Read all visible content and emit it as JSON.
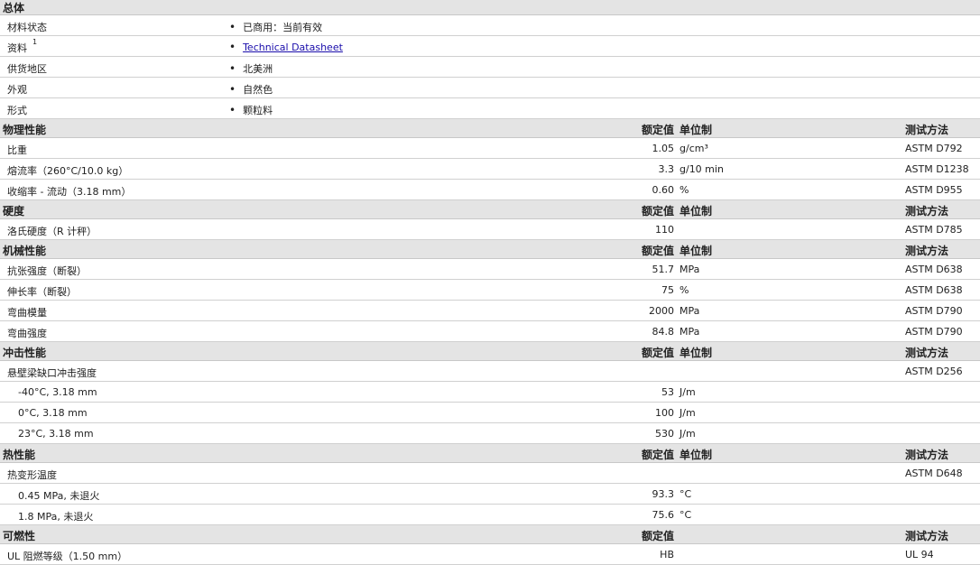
{
  "general": {
    "title": "总体",
    "rows": [
      {
        "label": "材料状态",
        "value": "已商用：当前有效"
      },
      {
        "label": "资料",
        "sup": "1",
        "value": "Technical Datasheet",
        "link": true
      },
      {
        "label": "供货地区",
        "value": "北美洲"
      },
      {
        "label": "外观",
        "value": "自然色"
      },
      {
        "label": "形式",
        "value": "颗粒料"
      }
    ]
  },
  "headers": {
    "value": "额定值",
    "unit": "单位制",
    "test": "测试方法"
  },
  "sections": [
    {
      "title": "物理性能",
      "unitHdr": true,
      "rows": [
        {
          "label": "比重",
          "value": "1.05",
          "unit": "g/cm³",
          "test": "ASTM D792"
        },
        {
          "label": "熔流率（260°C/10.0 kg）",
          "value": "3.3",
          "unit": "g/10 min",
          "test": "ASTM D1238"
        },
        {
          "label": "收缩率 - 流动（3.18 mm）",
          "value": "0.60",
          "unit": "%",
          "test": "ASTM D955"
        }
      ]
    },
    {
      "title": "硬度",
      "unitHdr": true,
      "rows": [
        {
          "label": "洛氏硬度（R 计秤）",
          "value": "110",
          "test": "ASTM D785"
        }
      ]
    },
    {
      "title": "机械性能",
      "unitHdr": true,
      "rows": [
        {
          "label": "抗张强度（断裂）",
          "value": "51.7",
          "unit": "MPa",
          "test": "ASTM D638"
        },
        {
          "label": "伸长率（断裂）",
          "value": "75",
          "unit": "%",
          "test": "ASTM D638"
        },
        {
          "label": "弯曲模量",
          "value": "2000",
          "unit": "MPa",
          "test": "ASTM D790"
        },
        {
          "label": "弯曲强度",
          "value": "84.8",
          "unit": "MPa",
          "test": "ASTM D790"
        }
      ]
    },
    {
      "title": "冲击性能",
      "unitHdr": true,
      "rows": [
        {
          "label": "悬壁梁缺口冲击强度",
          "test": "ASTM D256"
        },
        {
          "label": "-40°C, 3.18 mm",
          "sub": true,
          "value": "53",
          "unit": "J/m"
        },
        {
          "label": "0°C, 3.18 mm",
          "sub": true,
          "value": "100",
          "unit": "J/m"
        },
        {
          "label": "23°C, 3.18 mm",
          "sub": true,
          "value": "530",
          "unit": "J/m"
        }
      ]
    },
    {
      "title": "热性能",
      "unitHdr": true,
      "rows": [
        {
          "label": "热变形温度",
          "test": "ASTM D648"
        },
        {
          "label": "0.45 MPa, 未退火",
          "sub": true,
          "value": "93.3",
          "unit": "°C"
        },
        {
          "label": "1.8 MPa, 未退火",
          "sub": true,
          "value": "75.6",
          "unit": "°C"
        }
      ]
    },
    {
      "title": "可燃性",
      "unitHdr": false,
      "rows": [
        {
          "label": "UL 阻燃等级（1.50 mm）",
          "value": "HB",
          "test": "UL 94"
        }
      ]
    }
  ]
}
